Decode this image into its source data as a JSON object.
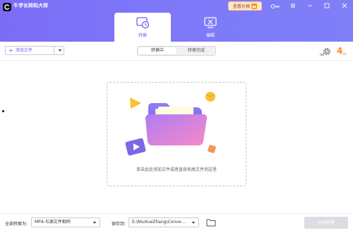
{
  "app": {
    "title": "牛学长转码大师",
    "logo_icon": "app-logo-icon"
  },
  "header": {
    "price_button": "查看价格",
    "price_icon": "gift-icon",
    "key_icon": "key-icon",
    "window_controls": [
      "menu-icon",
      "minimize-icon",
      "maximize-icon",
      "close-icon"
    ],
    "tabs": [
      {
        "label": "转换",
        "icon": "convert-icon",
        "active": true
      },
      {
        "label": "编辑",
        "icon": "edit-icon",
        "active": false
      }
    ]
  },
  "toolbar": {
    "add_files": "添加文件",
    "add_icon": "plus-icon",
    "dropdown_icon": "chevron-down-icon",
    "segments": [
      "转换中",
      "转换完成"
    ],
    "active_segment": "转换中",
    "gear_icon": "gpu-acceleration-icon",
    "gear_badge": "ON",
    "speed_icon": "4x-speed-icon"
  },
  "dropzone": {
    "hint": "单击此处添加文件或者直接拖拽文件到这里",
    "illustration": "folder-media-illustration"
  },
  "footer": {
    "format_label": "全部转换为:",
    "format_value": "MP4-与源文件相同",
    "save_label": "保存到:",
    "save_path": "E:\\NiuXueZhang\\Conve...",
    "folder_icon": "folder-icon",
    "convert_all": "全部转换"
  },
  "colors": {
    "accent": "#6b5ef0",
    "header": "#7e7af9",
    "price_bg": "#ffe6c7"
  }
}
